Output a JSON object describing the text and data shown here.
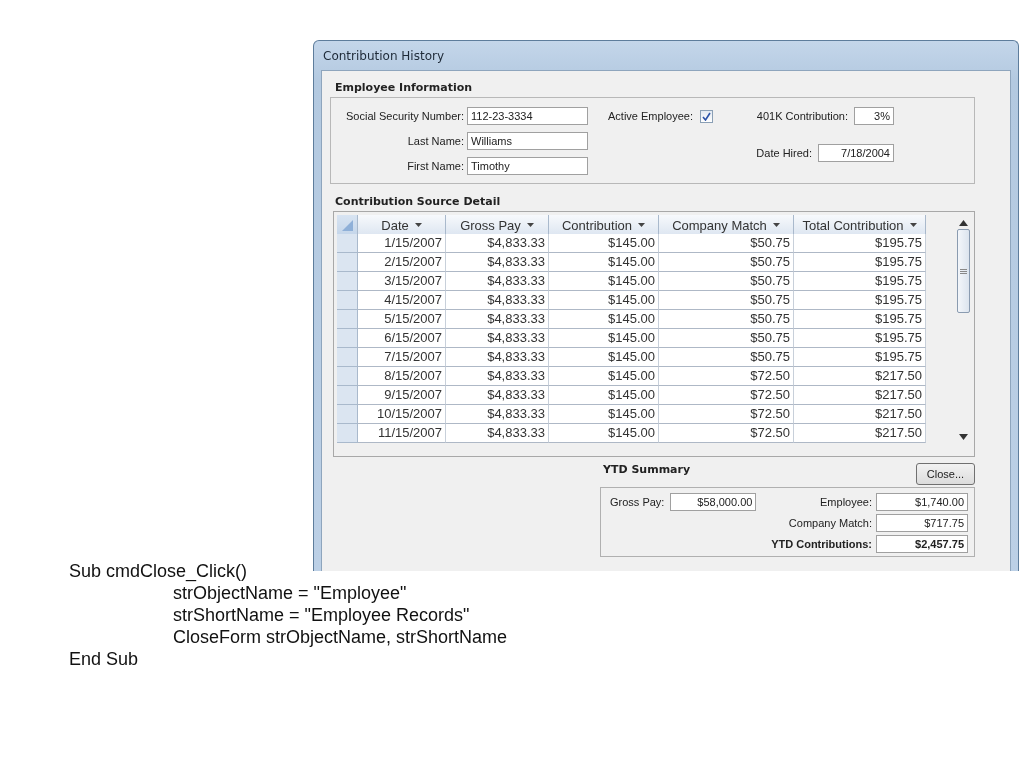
{
  "window": {
    "title": "Contribution History"
  },
  "employee_information": {
    "heading": "Employee Information",
    "fields": [
      {
        "label": "Social Security Number:",
        "value": "112-23-3334"
      },
      {
        "label": "Last Name:",
        "value": "Williams"
      },
      {
        "label": "First Name:",
        "value": "Timothy"
      }
    ],
    "active_employee": {
      "label": "Active Employee:",
      "checked": true
    },
    "contribution_401k": {
      "label": "401K Contribution:",
      "value": "3%"
    },
    "date_hired": {
      "label": "Date Hired:",
      "value": "7/18/2004"
    }
  },
  "contribution_source_detail": {
    "heading": "Contribution Source Detail",
    "columns": [
      "Date",
      "Gross Pay",
      "Contribution",
      "Company Match",
      "Total Contribution"
    ],
    "rows": [
      [
        "1/15/2007",
        "$4,833.33",
        "$145.00",
        "$50.75",
        "$195.75"
      ],
      [
        "2/15/2007",
        "$4,833.33",
        "$145.00",
        "$50.75",
        "$195.75"
      ],
      [
        "3/15/2007",
        "$4,833.33",
        "$145.00",
        "$50.75",
        "$195.75"
      ],
      [
        "4/15/2007",
        "$4,833.33",
        "$145.00",
        "$50.75",
        "$195.75"
      ],
      [
        "5/15/2007",
        "$4,833.33",
        "$145.00",
        "$50.75",
        "$195.75"
      ],
      [
        "6/15/2007",
        "$4,833.33",
        "$145.00",
        "$50.75",
        "$195.75"
      ],
      [
        "7/15/2007",
        "$4,833.33",
        "$145.00",
        "$50.75",
        "$195.75"
      ],
      [
        "8/15/2007",
        "$4,833.33",
        "$145.00",
        "$72.50",
        "$217.50"
      ],
      [
        "9/15/2007",
        "$4,833.33",
        "$145.00",
        "$72.50",
        "$217.50"
      ],
      [
        "10/15/2007",
        "$4,833.33",
        "$145.00",
        "$72.50",
        "$217.50"
      ],
      [
        "11/15/2007",
        "$4,833.33",
        "$145.00",
        "$72.50",
        "$217.50"
      ]
    ]
  },
  "ytd_summary": {
    "heading": "YTD Summary",
    "close_button": "Close...",
    "gross_pay": {
      "label": "Gross Pay:",
      "value": "$58,000.00"
    },
    "employee": {
      "label": "Employee:",
      "value": "$1,740.00"
    },
    "company_match": {
      "label": "Company Match:",
      "value": "$717.75"
    },
    "ytd_contributions": {
      "label": "YTD Contributions:",
      "value": "$2,457.75"
    }
  },
  "code": [
    {
      "text": "Sub cmdClose_Click()",
      "children": [
        {
          "text": "strObjectName = \"Employee\""
        },
        {
          "text": "strShortName = \"Employee Records\""
        },
        {
          "text": "CloseForm strObjectName, strShortName"
        }
      ]
    },
    {
      "text": "End Sub"
    }
  ]
}
